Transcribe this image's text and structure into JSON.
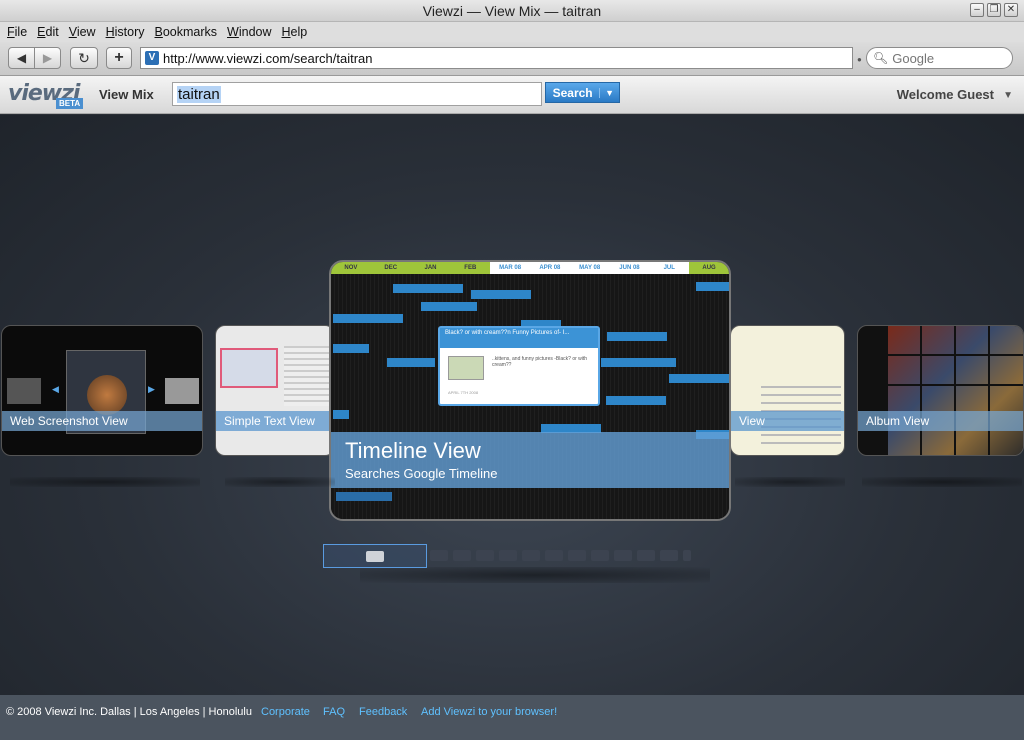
{
  "window": {
    "title": "Viewzi — View Mix — taitran"
  },
  "menu": [
    "File",
    "Edit",
    "View",
    "History",
    "Bookmarks",
    "Window",
    "Help"
  ],
  "browser": {
    "url": "http://www.viewzi.com/search/taitran",
    "search_placeholder": "Google"
  },
  "viewzi": {
    "logo": "viewzi",
    "beta": "BETA",
    "view_mix": "View Mix",
    "query": "taitran",
    "search_label": "Search",
    "welcome": "Welcome Guest"
  },
  "views": {
    "web_screenshot": "Web Screenshot View",
    "simple_text": "Simple Text View",
    "list_partial": "View",
    "album": "Album View",
    "main_title": "Timeline View",
    "main_subtitle": "Searches Google Timeline"
  },
  "timeline": {
    "months": [
      "NOV",
      "DEC",
      "JAN",
      "FEB",
      "MAR 08",
      "APR 08",
      "MAY 08",
      "JUN 08",
      "JUL",
      "AUG"
    ],
    "popup_title": "Black? or with cream??n Funny Pictures of- I...",
    "popup_text": "..kittens, and funny pictures -Black? or with cream??",
    "popup_date": "APRIL 7TH 2008"
  },
  "footer": {
    "copyright": "© 2008 Viewzi Inc. Dallas | Los Angeles | Honolulu",
    "links": [
      "Corporate",
      "FAQ",
      "Feedback",
      "Add Viewzi to your browser!"
    ]
  }
}
